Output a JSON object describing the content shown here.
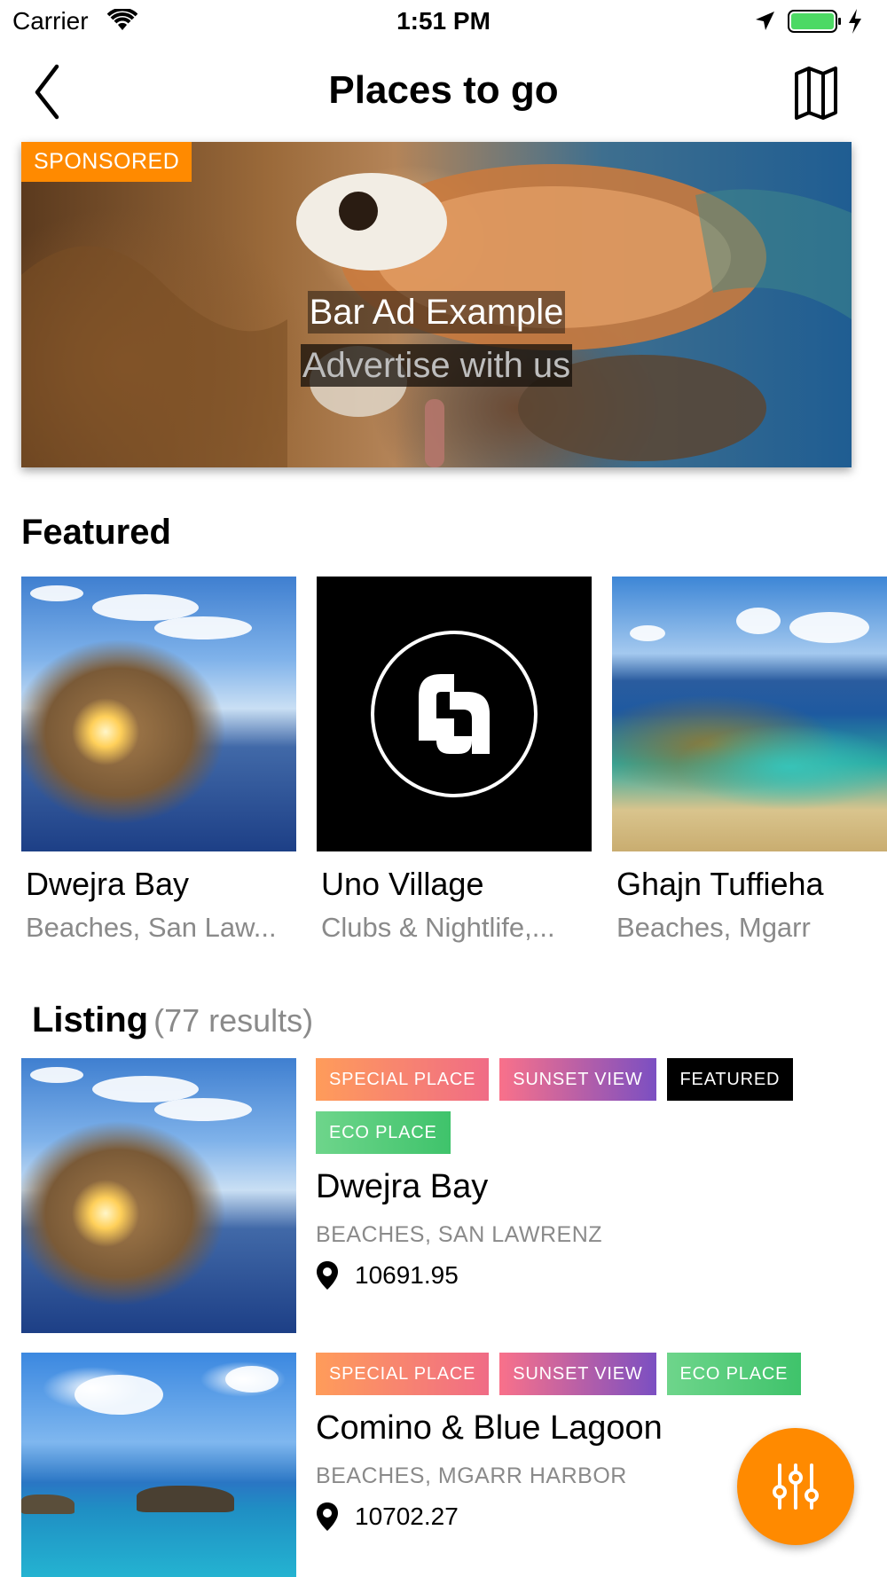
{
  "status_bar": {
    "carrier": "Carrier",
    "time": "1:51 PM"
  },
  "nav": {
    "title": "Places to go"
  },
  "banner": {
    "badge": "SPONSORED",
    "title": "Bar Ad Example",
    "subtitle": "Advertise with us"
  },
  "featured": {
    "title": "Featured",
    "items": [
      {
        "name": "Dwejra Bay",
        "subtitle": "Beaches, San Law..."
      },
      {
        "name": "Uno Village",
        "subtitle": "Clubs & Nightlife,..."
      },
      {
        "name": "Ghajn Tuffieha",
        "subtitle": "Beaches, Mgarr"
      }
    ]
  },
  "listing": {
    "title": "Listing",
    "count": "(77 results)",
    "items": [
      {
        "tags": [
          "SPECIAL PLACE",
          "SUNSET VIEW",
          "FEATURED",
          "ECO PLACE"
        ],
        "name": "Dwejra Bay",
        "category": "BEACHES, SAN LAWRENZ",
        "distance": "10691.95"
      },
      {
        "tags": [
          "SPECIAL PLACE",
          "SUNSET VIEW",
          "ECO PLACE"
        ],
        "name": "Comino & Blue Lagoon",
        "category": "BEACHES, MGARR HARBOR",
        "distance": "10702.27"
      }
    ]
  },
  "colors": {
    "accent": "#ff8a00",
    "muted_text": "#8a8a8a"
  },
  "icons": [
    "wifi-icon",
    "location-arrow-icon",
    "battery-icon",
    "charging-icon",
    "back-chevron-icon",
    "map-icon",
    "pin-icon",
    "filter-sliders-icon"
  ]
}
